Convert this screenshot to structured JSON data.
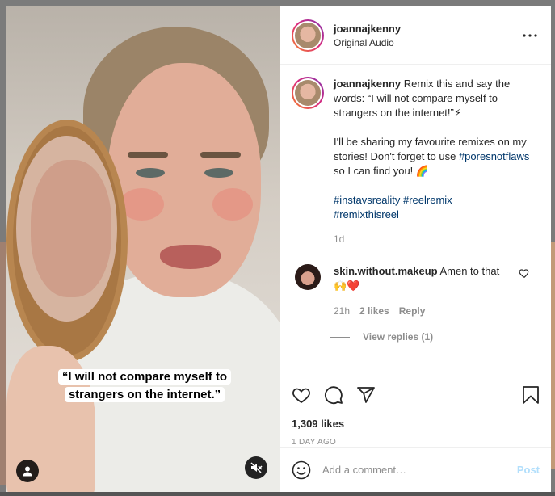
{
  "video": {
    "caption_line1": "“I will not compare myself to",
    "caption_line2": "strangers on the internet.”"
  },
  "header": {
    "username": "joannajkenny",
    "audio": "Original Audio",
    "more_icon": "more-horizontal-icon"
  },
  "post": {
    "username": "joannajkenny",
    "text_part1": "Remix this and say the words: “I will not compare myself to strangers on the internet!”",
    "emoji_bolt": "⚡",
    "text_part2_a": "I'll be sharing my favourite remixes on my stories! Don't forget to use ",
    "hashtag_pores": "#poresnotflaws",
    "text_part2_b": " so I can find you! ",
    "emoji_rainbow": "🌈",
    "hashtag_1": "#instavsreality",
    "hashtag_2": "#reelremix",
    "hashtag_3": "#remixthisreel",
    "timeago": "1d"
  },
  "comment": {
    "username": "skin.without.makeup",
    "text": "Amen to that ",
    "emojis": "🙌❤️",
    "time": "21h",
    "likes": "2 likes",
    "reply_label": "Reply",
    "view_replies": "View replies (1)"
  },
  "actions": {
    "likes": "1,309 likes",
    "date": "1 DAY AGO"
  },
  "add_comment": {
    "placeholder": "Add a comment…",
    "post_label": "Post"
  },
  "colors": {
    "hashtag": "#00376b",
    "post_disabled": "#b2dffc",
    "muted_text": "#8e8e8e"
  }
}
